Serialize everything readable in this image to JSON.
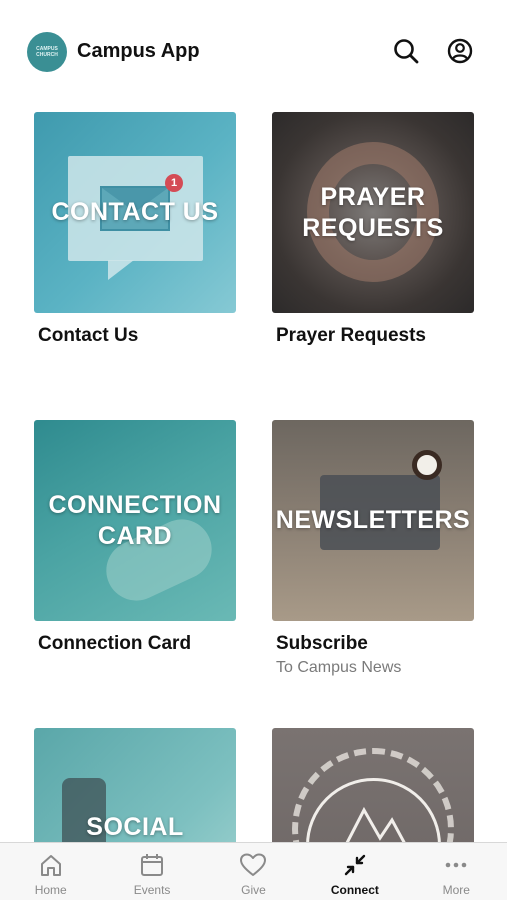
{
  "header": {
    "logo_text": "CAMPUS CHURCH",
    "title": "Campus App",
    "search_icon": "search-icon",
    "account_icon": "account-icon"
  },
  "tiles": [
    {
      "overlay": "CONTACT US",
      "label": "Contact Us",
      "badge": "1"
    },
    {
      "overlay": "PRAYER REQUESTS",
      "label": "Prayer Requests"
    },
    {
      "overlay": "CONNECTION CARD",
      "label": "Connection Card"
    },
    {
      "overlay": "NEWSLETTERS",
      "label": "Subscribe",
      "sublabel": "To Campus News"
    },
    {
      "overlay": "SOCIAL MEDIA",
      "label": ""
    },
    {
      "overlay": "",
      "label": ""
    }
  ],
  "tabbar": {
    "items": [
      {
        "label": "Home",
        "icon": "home-icon"
      },
      {
        "label": "Events",
        "icon": "calendar-icon"
      },
      {
        "label": "Give",
        "icon": "heart-icon"
      },
      {
        "label": "Connect",
        "icon": "connect-arrows-icon",
        "active": true
      },
      {
        "label": "More",
        "icon": "more-dots-icon"
      }
    ]
  },
  "colors": {
    "brand": "#3a8f94",
    "text": "#111111",
    "secondary_text": "#7a7a7a",
    "tab_inactive": "#8a8a8a",
    "badge": "#d44b55"
  }
}
